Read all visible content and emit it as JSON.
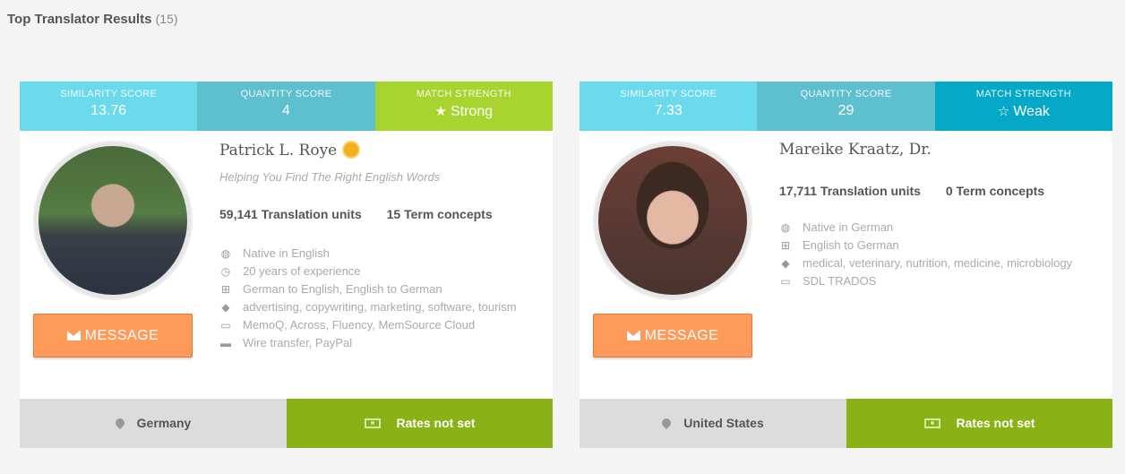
{
  "header": {
    "title": "Top Translator Results",
    "count": "(15)"
  },
  "translators": [
    {
      "scores": {
        "similarity_label": "SIMILARITY SCORE",
        "similarity_value": "13.76",
        "quantity_label": "QUANTITY SCORE",
        "quantity_value": "4",
        "match_label": "MATCH STRENGTH",
        "match_value": "Strong"
      },
      "name": "Patrick L. Roye",
      "tagline": "Helping You Find The Right English Words",
      "translation_units": "59,141 Translation units",
      "term_concepts": "15 Term concepts",
      "facts": {
        "native": "Native in English",
        "experience": "20 years of experience",
        "pairs": "German to English, English to German",
        "fields": "advertising, copywriting, marketing, software, tourism",
        "tools": "MemoQ, Across, Fluency, MemSource Cloud",
        "payment": "Wire transfer, PayPal"
      },
      "message_label": "MESSAGE",
      "location": "Germany",
      "rates": "Rates not set"
    },
    {
      "scores": {
        "similarity_label": "SIMILARITY SCORE",
        "similarity_value": "7.33",
        "quantity_label": "QUANTITY SCORE",
        "quantity_value": "29",
        "match_label": "MATCH STRENGTH",
        "match_value": "Weak"
      },
      "name": "Mareike Kraatz, Dr.",
      "translation_units": "17,711 Translation units",
      "term_concepts": "0 Term concepts",
      "facts": {
        "native": "Native in German",
        "pairs": "English to German",
        "fields": "medical, veterinary, nutrition, medicine, microbiology",
        "tools": "SDL TRADOS"
      },
      "message_label": "MESSAGE",
      "location": "United States",
      "rates": "Rates not set"
    }
  ],
  "colors": {
    "similarity": "#6cdaed",
    "quantity": "#5ebfcf",
    "strong": "#a8d430",
    "weak": "#05a8c6",
    "message_button": "#fe9a5a",
    "rates_bar": "#88b215",
    "location_bar": "#dcdcdc"
  },
  "icons": [
    "globe-icon",
    "clock-icon",
    "language-icon",
    "tags-icon",
    "monitor-icon",
    "credit-card-icon",
    "map-marker-icon",
    "money-icon",
    "envelope-icon",
    "star-icon",
    "star-half-icon",
    "badge-icon"
  ]
}
